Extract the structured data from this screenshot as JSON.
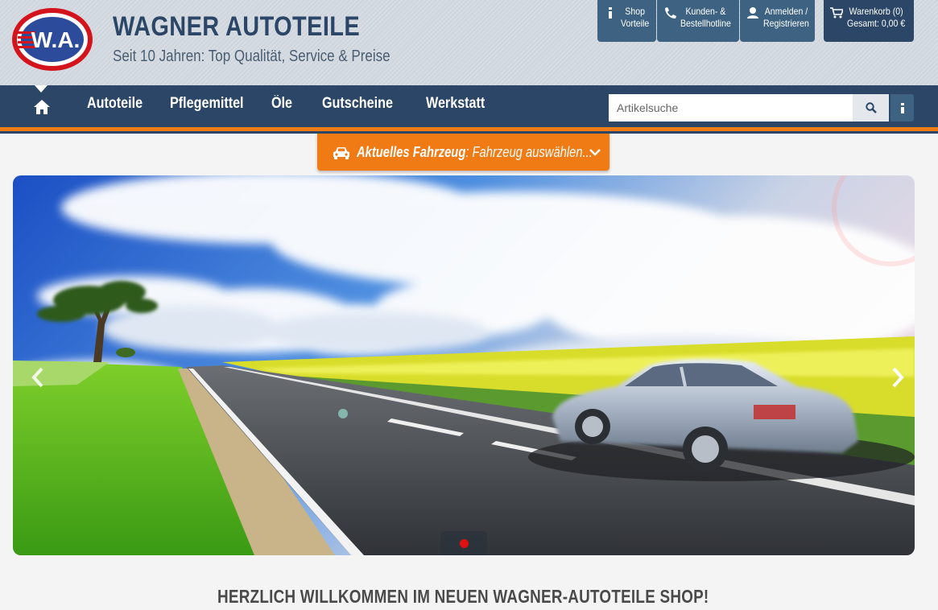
{
  "colors": {
    "brand_dark": "#2b4666",
    "brand_mid": "#3e6382",
    "accent_orange": "#f07a14",
    "logo_red": "#d4141c",
    "logo_blue": "#2d4b9b"
  },
  "brand": {
    "logo_text": "W.A.",
    "title": "WAGNER AUTOTEILE",
    "slogan": "Seit 10 Jahren: Top Qualität, Service & Preise"
  },
  "top_buttons": [
    {
      "icon": "info-icon",
      "label": "Shop\nVorteile"
    },
    {
      "icon": "phone-icon",
      "label": "Kunden- &\nBestellhotline"
    },
    {
      "icon": "user-icon",
      "label": "Anmelden /\nRegistrieren"
    },
    {
      "icon": "cart-icon",
      "label": "Warenkorb (0)\nGesamt: 0,00 €"
    }
  ],
  "nav": {
    "home_icon": "home-icon",
    "items": [
      "Autoteile",
      "Pflegemittel",
      "Öle",
      "Gutscheine",
      "Werkstatt"
    ]
  },
  "search": {
    "placeholder": "Artikelsuche",
    "button_icon": "search-icon",
    "info_icon": "info-icon"
  },
  "vehicle": {
    "label": "Aktuelles Fahrzeug",
    "value": ": Fahrzeug auswählen...",
    "icon": "car-icon",
    "chevron": "chevron-down-icon"
  },
  "slider": {
    "prev_icon": "chevron-left-icon",
    "next_icon": "chevron-right-icon",
    "active_slide": 1,
    "slide_count": 1
  },
  "welcome": "HERZLICH WILLKOMMEN IM NEUEN WAGNER-AUTOTEILE SHOP!"
}
